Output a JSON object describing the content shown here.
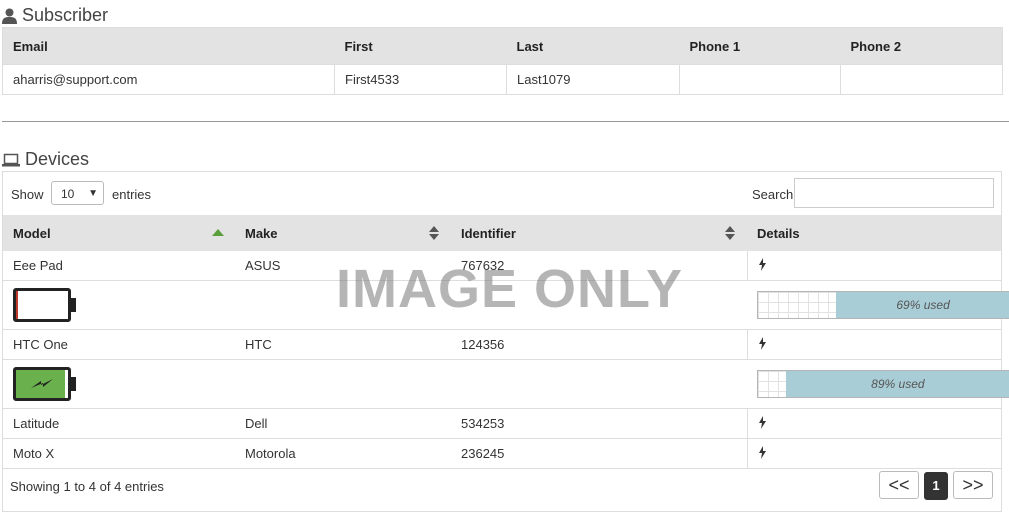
{
  "subscriber": {
    "title": "Subscriber",
    "columns": [
      "Email",
      "First",
      "Last",
      "Phone 1",
      "Phone 2"
    ],
    "row": [
      "aharris@support.com",
      "First4533",
      "Last1079",
      "",
      ""
    ]
  },
  "devices": {
    "title": "Devices",
    "length_menu": {
      "show_label": "Show",
      "selected": "10",
      "entries_label": "entries"
    },
    "search_label": "Search:",
    "search_value": "",
    "columns": [
      "Model",
      "Make",
      "Identifier",
      "Details"
    ],
    "rows": [
      {
        "model": "Eee Pad",
        "make": "ASUS",
        "identifier": "767632",
        "battery_level": 0.03,
        "battery_charging": false,
        "usage_percent": 69,
        "usage_text": "69% used"
      },
      {
        "model": "HTC One",
        "make": "HTC",
        "identifier": "124356",
        "battery_level": 0.95,
        "battery_charging": true,
        "usage_percent": 89,
        "usage_text": "89% used"
      },
      {
        "model": "Latitude",
        "make": "Dell",
        "identifier": "534253"
      },
      {
        "model": "Moto X",
        "make": "Motorola",
        "identifier": "236245"
      }
    ],
    "info": "Showing 1 to 4 of 4 entries",
    "pagination": {
      "prev": "<<",
      "current": "1",
      "next": ">>"
    }
  },
  "watermark": "IMAGE ONLY",
  "colors": {
    "header_bg": "#e3e3e3",
    "sort_active": "#5b9e3c",
    "battery_low": "#c0392b",
    "battery_ok": "#6ab04c",
    "usage_fill": "#a9cdd6"
  },
  "icons": {
    "subscriber": "user-icon",
    "devices": "laptop-icon",
    "details": "lightning-icon",
    "sort_asc": "sort-asc-icon",
    "sort_both": "sort-both-icon"
  }
}
